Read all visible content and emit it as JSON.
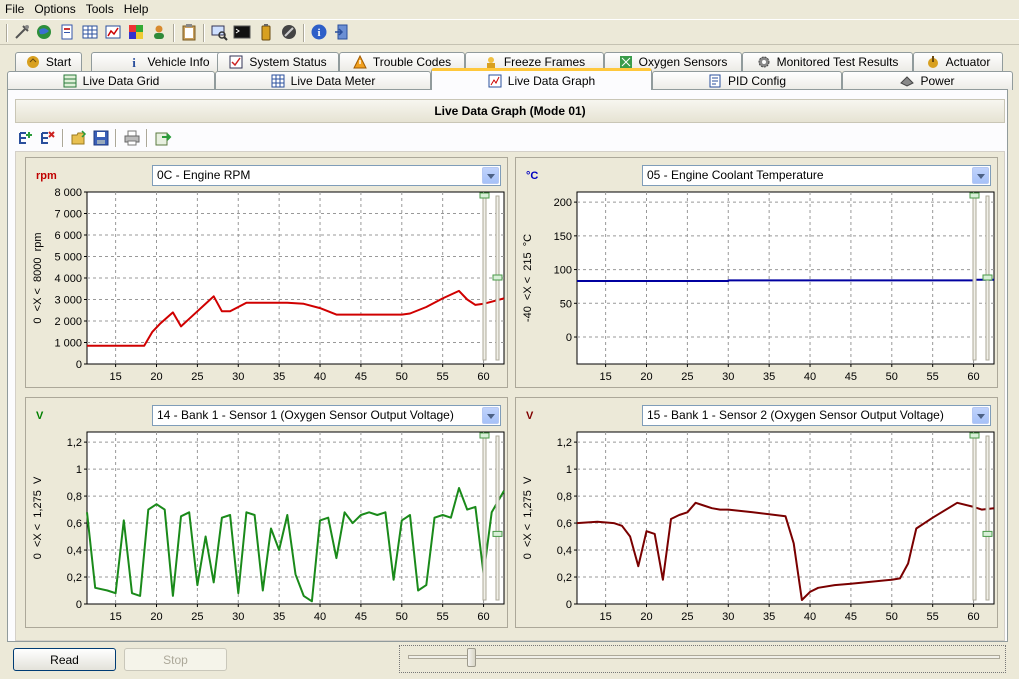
{
  "menu": [
    "File",
    "Options",
    "Tools",
    "Help"
  ],
  "tabs_row1": [
    {
      "label": "Start",
      "icon": "start-icon"
    },
    {
      "label": "Vehicle Info",
      "icon": "info-icon"
    },
    {
      "label": "System Status",
      "icon": "checklist-icon"
    },
    {
      "label": "Trouble Codes",
      "icon": "warning-icon"
    },
    {
      "label": "Freeze Frames",
      "icon": "freeze-icon"
    },
    {
      "label": "Oxygen Sensors",
      "icon": "sensor-icon"
    },
    {
      "label": "Monitored Test Results",
      "icon": "gear-icon"
    },
    {
      "label": "Actuator",
      "icon": "actuator-icon"
    }
  ],
  "tabs_row2": [
    {
      "label": "Live Data Grid",
      "icon": "grid-icon"
    },
    {
      "label": "Live Data Meter",
      "icon": "meter-icon"
    },
    {
      "label": "Live Data Graph",
      "icon": "graph-icon",
      "active": true
    },
    {
      "label": "PID Config",
      "icon": "config-icon"
    },
    {
      "label": "Power",
      "icon": "power-icon"
    }
  ],
  "panel_title": "Live Data Graph (Mode 01)",
  "buttons": {
    "read": "Read",
    "stop": "Stop"
  },
  "slider": {
    "position": 0.1
  },
  "charts": [
    {
      "id": "rpm",
      "unit": "rpm",
      "unit_color": "#c00000",
      "pid": "0C - Engine RPM",
      "range_label": "0  <X <  8000  rpm",
      "line_color": "#d00000",
      "y_ticks": [
        "0",
        "1 000",
        "2 000",
        "3 000",
        "4 000",
        "5 000",
        "6 000",
        "7 000",
        "8 000"
      ],
      "y_min": 0,
      "y_max": 8000,
      "x_ticks": [
        "15",
        "20",
        "25",
        "30",
        "35",
        "40",
        "45",
        "50",
        "55",
        "60"
      ],
      "x_min": 11.5,
      "x_max": 62.5,
      "level": 0.5,
      "chart_data": {
        "type": "line",
        "x": [
          11.5,
          13,
          15,
          17,
          18.5,
          19.5,
          20.5,
          22,
          23,
          24,
          26,
          27,
          28,
          29,
          30,
          31,
          32,
          34,
          36,
          38,
          40,
          42,
          45,
          50,
          51,
          53,
          55,
          57,
          58,
          59,
          60,
          61,
          62.5
        ],
        "y": [
          850,
          850,
          850,
          850,
          850,
          1500,
          1900,
          2400,
          1750,
          2100,
          2800,
          3150,
          2450,
          2450,
          2650,
          2850,
          2850,
          2850,
          2850,
          2800,
          2600,
          2300,
          2300,
          2300,
          2350,
          2650,
          3050,
          3400,
          3000,
          2750,
          2800,
          2900,
          3050
        ]
      }
    },
    {
      "id": "coolant",
      "unit": "°C",
      "unit_color": "#0000c0",
      "pid": "05 - Engine Coolant Temperature",
      "range_label": "-40  <X <  215  °C",
      "line_color": "#0000a0",
      "y_ticks": [
        "0",
        "50",
        "100",
        "150",
        "200"
      ],
      "y_tick_values": [
        0,
        50,
        100,
        150,
        200
      ],
      "y_min": -40,
      "y_max": 215,
      "x_ticks": [
        "15",
        "20",
        "25",
        "30",
        "35",
        "40",
        "45",
        "50",
        "55",
        "60"
      ],
      "x_min": 11.5,
      "x_max": 62.5,
      "level": 0.5,
      "chart_data": {
        "type": "line",
        "x": [
          11.5,
          30,
          30,
          60,
          60,
          62.5
        ],
        "y": [
          83,
          83,
          84,
          84,
          85,
          85
        ]
      }
    },
    {
      "id": "o2s1",
      "unit": "V",
      "unit_color": "#008000",
      "pid": "14 - Bank 1 - Sensor 1 (Oxygen Sensor Output Voltage)",
      "range_label": "0  <X <  1,275  V",
      "line_color": "#1a8a1a",
      "y_ticks": [
        "0",
        "0,2",
        "0,4",
        "0,6",
        "0,8",
        "1",
        "1,2"
      ],
      "y_tick_values": [
        0,
        0.2,
        0.4,
        0.6,
        0.8,
        1.0,
        1.2
      ],
      "y_min": 0,
      "y_max": 1.275,
      "x_ticks": [
        "15",
        "20",
        "25",
        "30",
        "35",
        "40",
        "45",
        "50",
        "55",
        "60"
      ],
      "x_min": 11.5,
      "x_max": 62.5,
      "level": 0.6,
      "chart_data": {
        "type": "line",
        "x": [
          11.5,
          12.5,
          14,
          15,
          16,
          17,
          18,
          19,
          20,
          21,
          22,
          23,
          24,
          25,
          26,
          27,
          28,
          29,
          30,
          31,
          32,
          33,
          34,
          35,
          36,
          37,
          38,
          39,
          40,
          41,
          42,
          43,
          44,
          45,
          46,
          47,
          48,
          49,
          50,
          51,
          52,
          53,
          54,
          55,
          56,
          57,
          58,
          59,
          60,
          61,
          62.5
        ],
        "y": [
          0.68,
          0.12,
          0.1,
          0.08,
          0.62,
          0.08,
          0.06,
          0.7,
          0.74,
          0.7,
          0.06,
          0.65,
          0.68,
          0.14,
          0.5,
          0.16,
          0.64,
          0.66,
          0.08,
          0.68,
          0.66,
          0.1,
          0.56,
          0.4,
          0.66,
          0.22,
          0.06,
          0.02,
          0.62,
          0.64,
          0.34,
          0.68,
          0.6,
          0.66,
          0.68,
          0.66,
          0.68,
          0.18,
          0.62,
          0.66,
          0.1,
          0.14,
          0.64,
          0.66,
          0.64,
          0.86,
          0.7,
          0.72,
          0.22,
          0.68,
          0.84
        ]
      }
    },
    {
      "id": "o2s2",
      "unit": "V",
      "unit_color": "#800000",
      "pid": "15 - Bank 1 - Sensor 2 (Oxygen Sensor Output Voltage)",
      "range_label": "0  <X <  1,275  V",
      "line_color": "#7a0000",
      "y_ticks": [
        "0",
        "0,2",
        "0,4",
        "0,6",
        "0,8",
        "1",
        "1,2"
      ],
      "y_tick_values": [
        0,
        0.2,
        0.4,
        0.6,
        0.8,
        1.0,
        1.2
      ],
      "y_min": 0,
      "y_max": 1.275,
      "x_ticks": [
        "15",
        "20",
        "25",
        "30",
        "35",
        "40",
        "45",
        "50",
        "55",
        "60"
      ],
      "x_min": 11.5,
      "x_max": 62.5,
      "level": 0.6,
      "chart_data": {
        "type": "line",
        "x": [
          11.5,
          14,
          16,
          17,
          18,
          19,
          20,
          21,
          22,
          23,
          24,
          25,
          26,
          27,
          28,
          29,
          30,
          33,
          37,
          38,
          39,
          40,
          41,
          43,
          45,
          50,
          51,
          52,
          53,
          55,
          58,
          60,
          61,
          62.5
        ],
        "y": [
          0.6,
          0.61,
          0.6,
          0.58,
          0.5,
          0.28,
          0.54,
          0.52,
          0.18,
          0.63,
          0.66,
          0.68,
          0.75,
          0.73,
          0.71,
          0.7,
          0.7,
          0.68,
          0.65,
          0.45,
          0.03,
          0.09,
          0.12,
          0.14,
          0.15,
          0.18,
          0.19,
          0.3,
          0.56,
          0.64,
          0.75,
          0.72,
          0.7,
          0.71
        ]
      }
    }
  ]
}
